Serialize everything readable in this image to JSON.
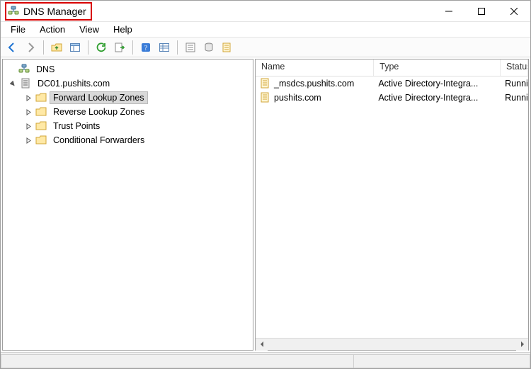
{
  "window": {
    "title": "DNS Manager"
  },
  "menu": {
    "items": [
      "File",
      "Action",
      "View",
      "Help"
    ]
  },
  "toolbar": {
    "icons": [
      "nav-back-icon",
      "nav-forward-icon",
      "sep",
      "up-folder-icon",
      "show-hide-tree-icon",
      "sep",
      "refresh-icon",
      "export-list-icon",
      "sep",
      "help-icon",
      "details-view-icon",
      "sep",
      "filter-icon",
      "script-icon",
      "new-zone-icon"
    ]
  },
  "tree": {
    "root_label": "DNS",
    "server": "DC01.pushits.com",
    "children": [
      {
        "label": "Forward Lookup Zones",
        "selected": true
      },
      {
        "label": "Reverse Lookup Zones",
        "selected": false
      },
      {
        "label": "Trust Points",
        "selected": false
      },
      {
        "label": "Conditional Forwarders",
        "selected": false
      }
    ]
  },
  "list": {
    "columns": {
      "name": "Name",
      "type": "Type",
      "status": "Status"
    },
    "rows": [
      {
        "name": "_msdcs.pushits.com",
        "type": "Active Directory-Integra...",
        "status": "Running"
      },
      {
        "name": "pushits.com",
        "type": "Active Directory-Integra...",
        "status": "Running"
      }
    ]
  }
}
